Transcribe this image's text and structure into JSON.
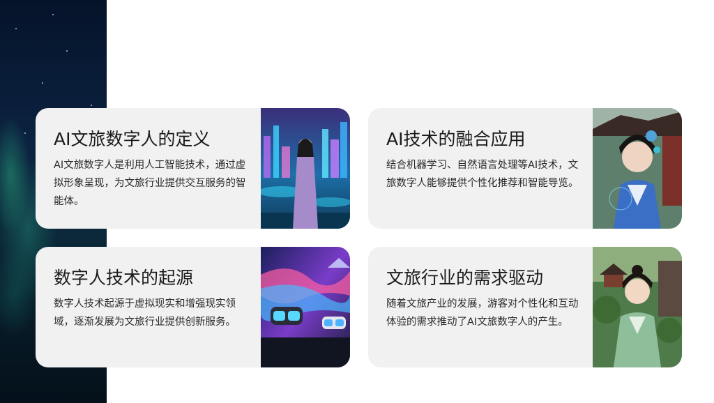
{
  "cards": [
    {
      "title": "AI文旅数字人的定义",
      "body": "AI文旅数字人是利用人工智能技术，通过虚拟形象呈现，为文旅行业提供交互服务的智能体。",
      "image_icon": "digital-human-city-image"
    },
    {
      "title": "AI技术的融合应用",
      "body": "结合机器学习、自然语言处理等AI技术，文旅数字人能够提供个性化推荐和智能导览。",
      "image_icon": "ai-hanfu-woman-image"
    },
    {
      "title": "数字人技术的起源",
      "body": "数字人技术起源于虚拟现实和增强现实领域，逐渐发展为文旅行业提供创新服务。",
      "image_icon": "vr-headset-image"
    },
    {
      "title": "文旅行业的需求驱动",
      "body": "随着文旅产业的发展，游客对个性化和互动体验的需求推动了AI文旅数字人的产生。",
      "image_icon": "hanfu-garden-woman-image"
    }
  ]
}
